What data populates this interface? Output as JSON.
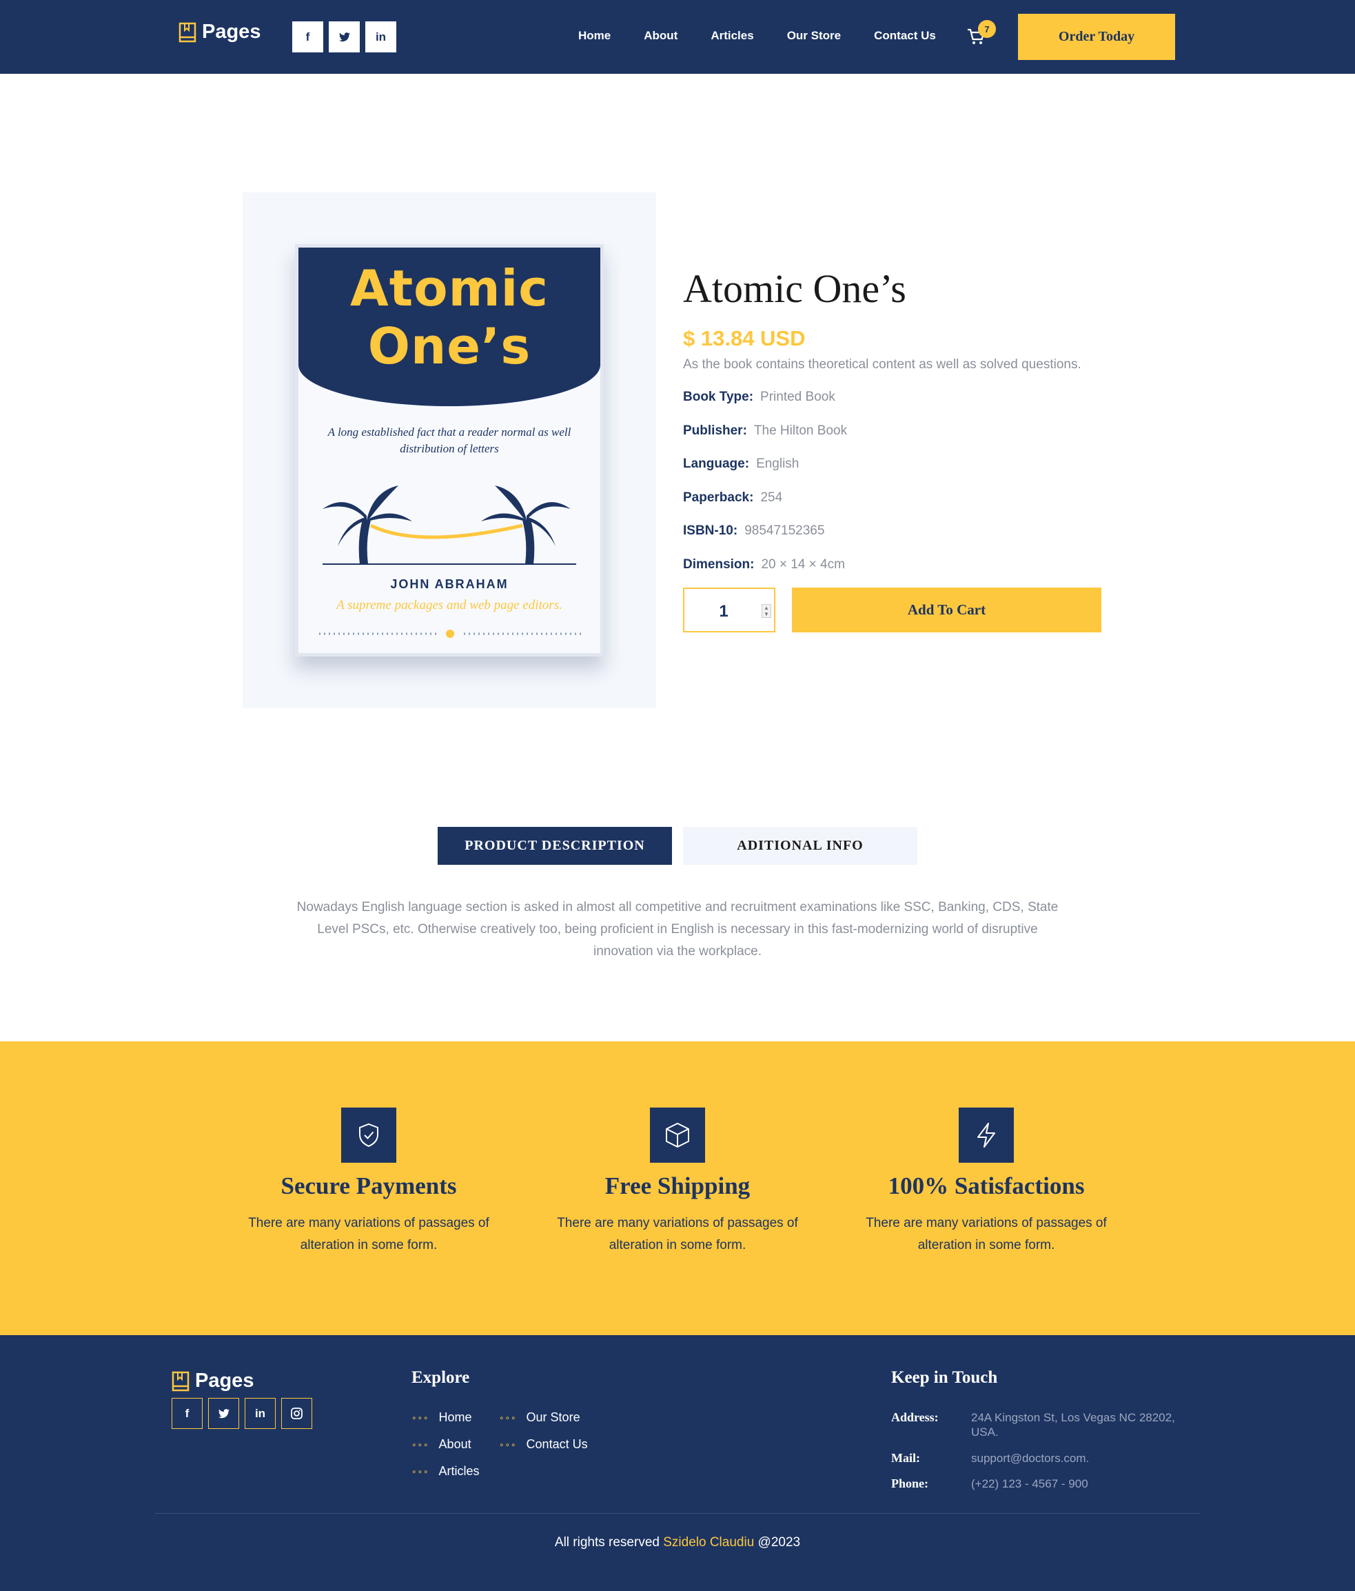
{
  "header": {
    "logo_text": "Pages",
    "social": [
      "f",
      "t",
      "in"
    ],
    "nav": [
      "Home",
      "About",
      "Articles",
      "Our Store",
      "Contact Us"
    ],
    "cart_count": "7",
    "order_button": "Order Today"
  },
  "product": {
    "cover": {
      "title_line1": "Atomic",
      "title_line2": "One’s",
      "tagline": "A long established fact that a reader normal as well distribution of letters",
      "author": "JOHN ABRAHAM",
      "subtitle": "A supreme packages and web page editors."
    },
    "title": "Atomic One’s",
    "price": "$ 13.84 USD",
    "description": "As the book contains theoretical content as well as solved questions.",
    "specs": [
      {
        "label": "Book Type:",
        "value": "Printed Book"
      },
      {
        "label": "Publisher:",
        "value": "The Hilton Book"
      },
      {
        "label": "Language:",
        "value": "English"
      },
      {
        "label": "Paperback:",
        "value": "254"
      },
      {
        "label": "ISBN-10:",
        "value": "98547152365"
      },
      {
        "label": "Dimension:",
        "value": "20 × 14 × 4cm"
      }
    ],
    "quantity": "1",
    "add_to_cart": "Add To Cart"
  },
  "tabs": {
    "active": "PRODUCT DESCRIPTION",
    "inactive": "ADITIONAL INFO",
    "text": "Nowadays English language section is asked in almost all competitive and recruitment examinations like SSC, Banking, CDS, State Level PSCs, etc. Otherwise creatively too, being proficient in English is necessary in this fast-modernizing world of disruptive innovation via the workplace."
  },
  "features": [
    {
      "icon": "shield-check-icon",
      "title": "Secure Payments",
      "text": "There are many variations of passages of alteration in some form."
    },
    {
      "icon": "box-icon",
      "title": "Free Shipping",
      "text": "There are many variations of passages of alteration in some form."
    },
    {
      "icon": "lightning-icon",
      "title": "100% Satisfactions",
      "text": "There are many variations of passages of alteration in some form."
    }
  ],
  "footer": {
    "logo_text": "Pages",
    "social": [
      "f",
      "t",
      "in",
      "ig"
    ],
    "explore_title": "Explore",
    "explore_links": [
      "Home",
      "About",
      "Articles",
      "Our Store",
      "Contact Us"
    ],
    "contact_title": "Keep in Touch",
    "address_label": "Address:",
    "address": "24A Kingston St, Los Vegas NC 28202, USA.",
    "mail_label": "Mail:",
    "mail": "support@doctors.com.",
    "phone_label": "Phone:",
    "phone": "(+22) 123 - 4567 - 900",
    "copyright_prefix": "All rights reserved",
    "copyright_name": "Szidelo Claudiu",
    "copyright_year": "@2023"
  },
  "colors": {
    "navy": "#1d3461",
    "accent": "#fdc73e",
    "muted": "#8a8f99"
  }
}
